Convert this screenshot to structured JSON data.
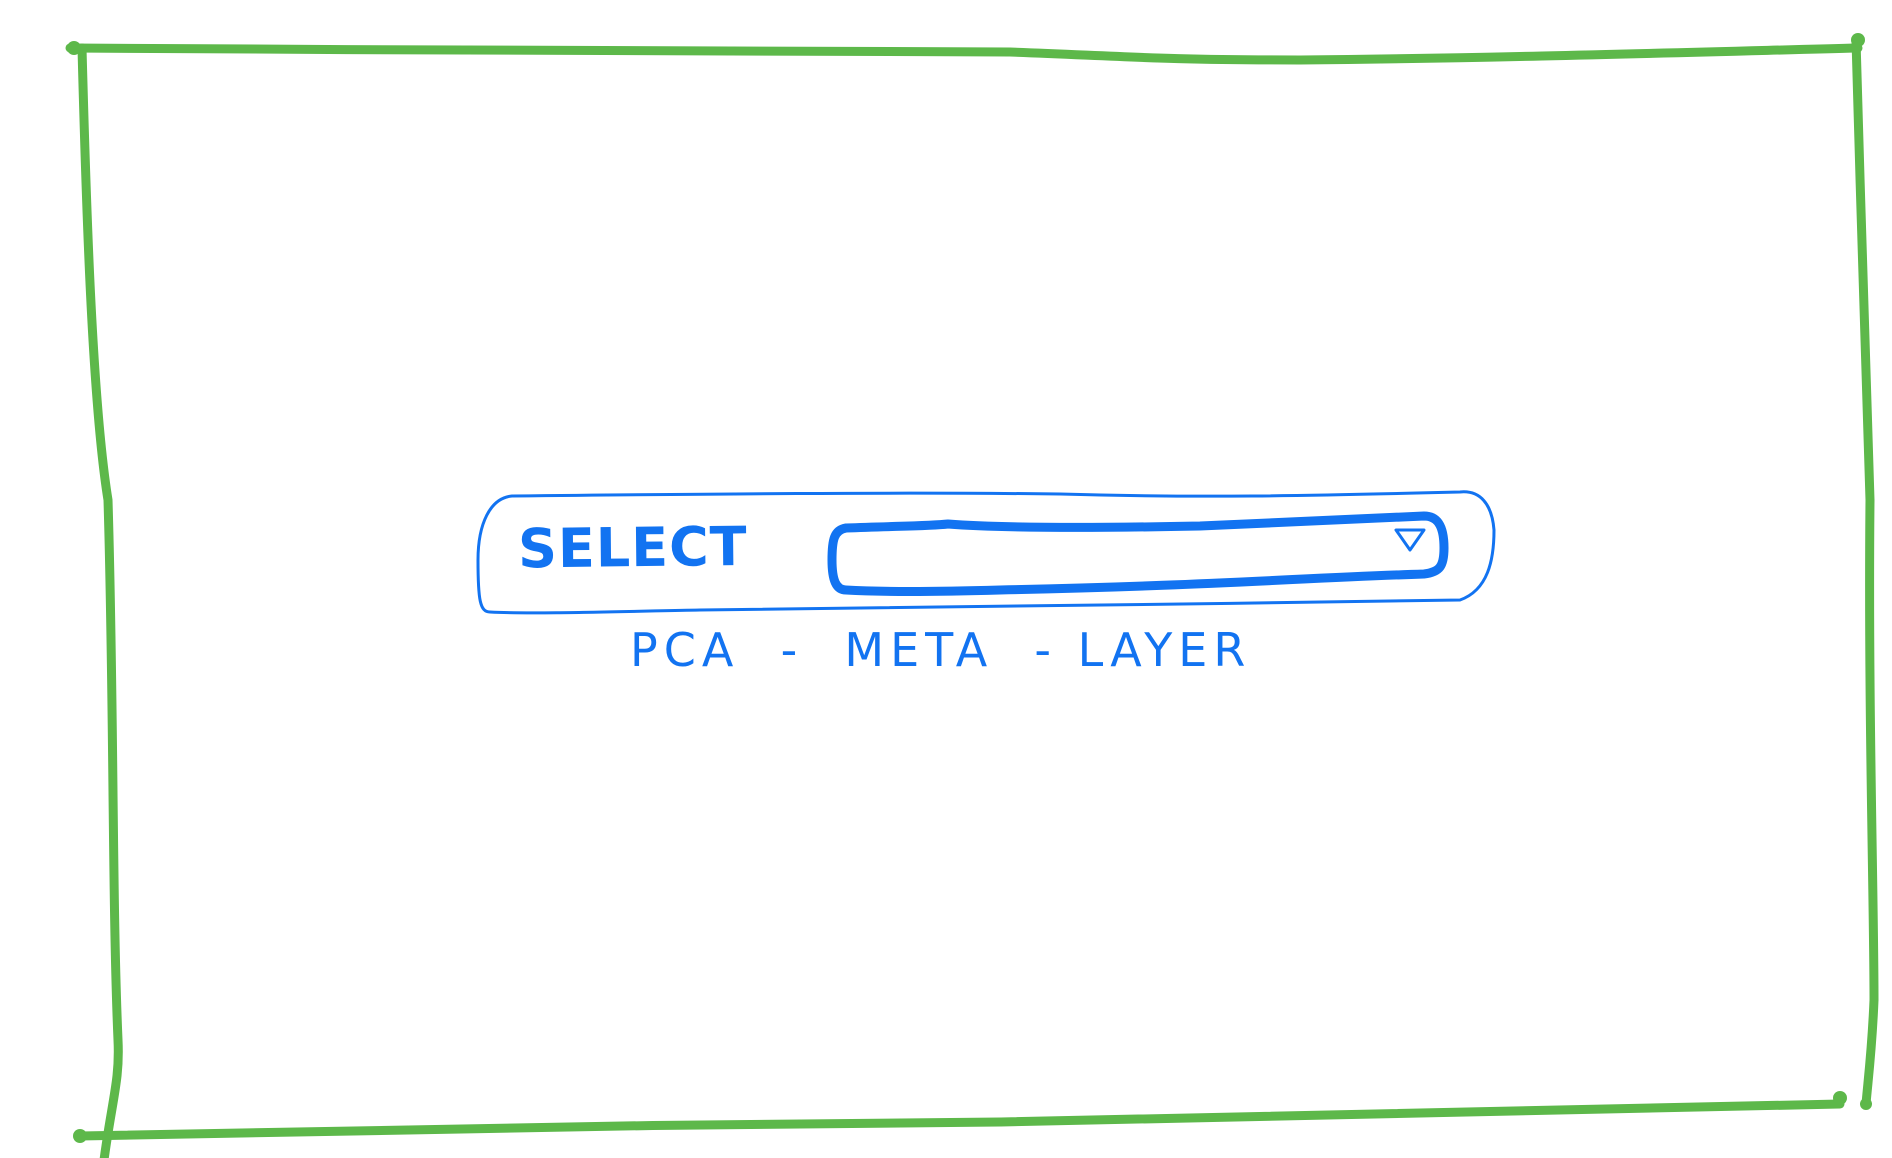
{
  "select": {
    "label": "SELECT",
    "value": "",
    "dropdown_icon": "triangle-down-icon"
  },
  "caption": {
    "text": "PCA  -  META  - LAYER"
  },
  "colors": {
    "frame": "#5DB84A",
    "sketch": "#1273F1",
    "background": "#FFFFFF"
  }
}
